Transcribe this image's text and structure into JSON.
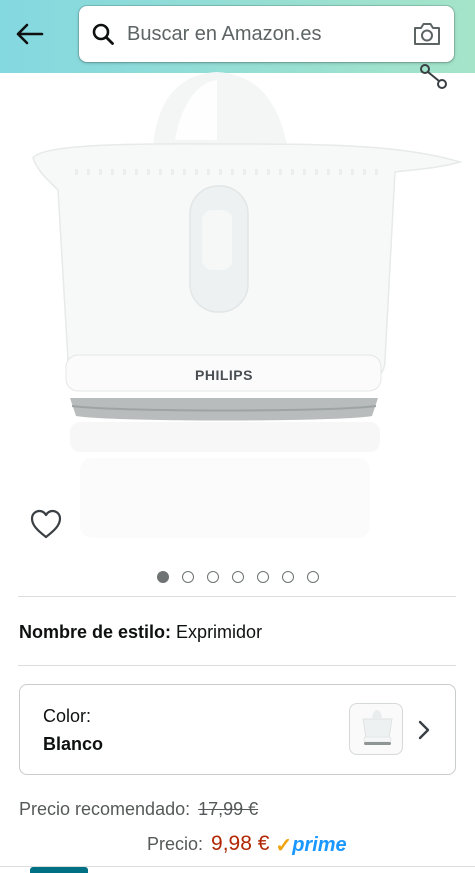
{
  "search": {
    "placeholder": "Buscar en Amazon.es"
  },
  "product": {
    "brand_printed": "PHILIPS",
    "gallery_total_images": 7,
    "gallery_active_index": 0
  },
  "style_selection": {
    "label": "Nombre de estilo:",
    "value": "Exprimidor"
  },
  "color_selection": {
    "label": "Color:",
    "value": "Blanco"
  },
  "pricing": {
    "rrp_label": "Precio recomendado:",
    "rrp_value": "17,99 €",
    "price_label": "Precio:",
    "price_value": "9,98 €",
    "prime_label": "prime"
  },
  "icons": {
    "back": "back-arrow-icon",
    "search": "search-icon",
    "camera": "camera-icon",
    "share": "share-icon",
    "wishlist": "heart-icon",
    "chevron": "chevron-right-icon",
    "prime_check": "prime-check-icon"
  },
  "colors": {
    "header_start": "#84d8e0",
    "header_end": "#a5e4c9",
    "price_red": "#b12704",
    "prime_blue": "#1a98ff",
    "prime_orange": "#f0a30a",
    "accent_teal": "#007185"
  }
}
